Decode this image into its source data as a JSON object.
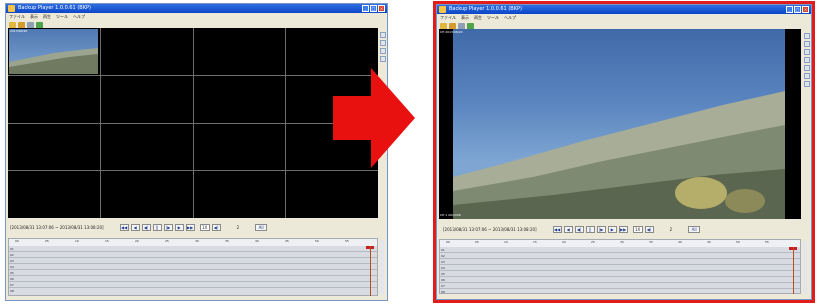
{
  "left_window": {
    "title": "Backup Player 1.0.0.61 (BKP)",
    "menu": [
      "ファイル",
      "表示",
      "再生",
      "ツール",
      "ヘルプ"
    ],
    "camera_label": "2013/06/20",
    "time_range": "[2013/08/31 13:07:06 ~ 2013/08/31 13:08:20]",
    "speed": "1X",
    "page": "2",
    "all_button": "All",
    "ruler_ticks": [
      "00",
      "05",
      "10",
      "15",
      "20",
      "25",
      "30",
      "35",
      "40",
      "45",
      "50",
      "55"
    ],
    "rows": [
      "01",
      "02",
      "03",
      "04",
      "05",
      "06",
      "07",
      "08"
    ]
  },
  "right_window": {
    "title": "Backup Player 1.0.0.61 (BKP)",
    "menu": [
      "ファイル",
      "表示",
      "再生",
      "ツール",
      "ヘルプ"
    ],
    "camera_label": "CH 2013/06/20",
    "osd_bottom": "CH 1 2013/06",
    "time_range": "[2013/08/31 13:07:06 ~ 2013/08/31 13:08:20]",
    "speed": "1X",
    "page": "2",
    "all_button": "All",
    "ruler_ticks": [
      "00",
      "05",
      "10",
      "15",
      "20",
      "25",
      "30",
      "35",
      "40",
      "45",
      "50",
      "55"
    ],
    "rows": [
      "01",
      "02",
      "03",
      "04",
      "05",
      "06",
      "07",
      "08"
    ]
  },
  "playback_buttons": [
    "◀◀",
    "◀",
    "◀|",
    "||",
    "|▶",
    "▶",
    "▶▶"
  ],
  "colors": {
    "accent_red": "#e21c1c",
    "title_blue": "#0b46c8",
    "arrow_red": "#e8110f"
  },
  "icons": [
    "arrow-right-icon",
    "app-icon",
    "open-icon",
    "save-icon",
    "print-icon",
    "export-icon"
  ]
}
